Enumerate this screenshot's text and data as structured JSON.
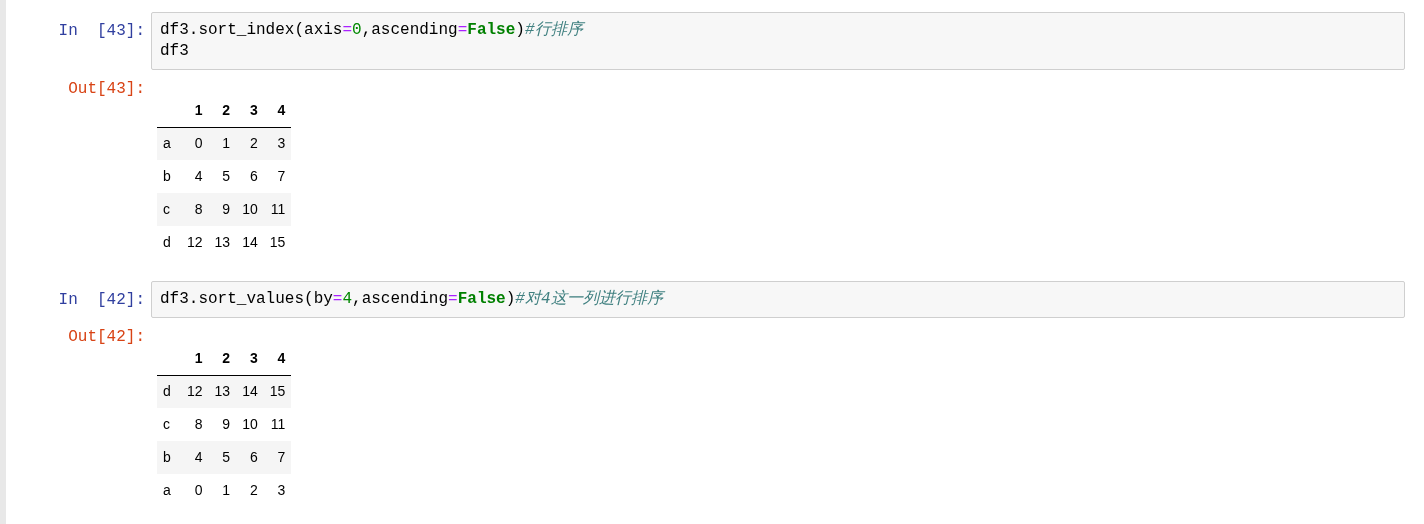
{
  "cells": [
    {
      "in_prompt": "In  [43]:",
      "code_lines": [
        [
          {
            "kind": "name",
            "text": "df3.sort_index(axis"
          },
          {
            "kind": "operator",
            "text": "="
          },
          {
            "kind": "number",
            "text": "0"
          },
          {
            "kind": "name",
            "text": ",ascending"
          },
          {
            "kind": "operator",
            "text": "="
          },
          {
            "kind": "keyword",
            "text": "False"
          },
          {
            "kind": "name",
            "text": ")"
          },
          {
            "kind": "comment",
            "text": "#行排序"
          }
        ],
        [
          {
            "kind": "name",
            "text": "df3"
          }
        ]
      ],
      "out_prompt": "Out[43]:",
      "table": {
        "columns": [
          "1",
          "2",
          "3",
          "4"
        ],
        "rows": [
          {
            "index": "a",
            "cells": [
              "0",
              "1",
              "2",
              "3"
            ]
          },
          {
            "index": "b",
            "cells": [
              "4",
              "5",
              "6",
              "7"
            ]
          },
          {
            "index": "c",
            "cells": [
              "8",
              "9",
              "10",
              "11"
            ]
          },
          {
            "index": "d",
            "cells": [
              "12",
              "13",
              "14",
              "15"
            ]
          }
        ]
      }
    },
    {
      "in_prompt": "In  [42]:",
      "code_lines": [
        [
          {
            "kind": "name",
            "text": "df3.sort_values(by"
          },
          {
            "kind": "operator",
            "text": "="
          },
          {
            "kind": "number",
            "text": "4"
          },
          {
            "kind": "name",
            "text": ",ascending"
          },
          {
            "kind": "operator",
            "text": "="
          },
          {
            "kind": "keyword",
            "text": "False"
          },
          {
            "kind": "name",
            "text": ")"
          },
          {
            "kind": "comment",
            "text": "#对4这一列进行排序"
          }
        ]
      ],
      "out_prompt": "Out[42]:",
      "table": {
        "columns": [
          "1",
          "2",
          "3",
          "4"
        ],
        "rows": [
          {
            "index": "d",
            "cells": [
              "12",
              "13",
              "14",
              "15"
            ]
          },
          {
            "index": "c",
            "cells": [
              "8",
              "9",
              "10",
              "11"
            ]
          },
          {
            "index": "b",
            "cells": [
              "4",
              "5",
              "6",
              "7"
            ]
          },
          {
            "index": "a",
            "cells": [
              "0",
              "1",
              "2",
              "3"
            ]
          }
        ]
      }
    }
  ]
}
